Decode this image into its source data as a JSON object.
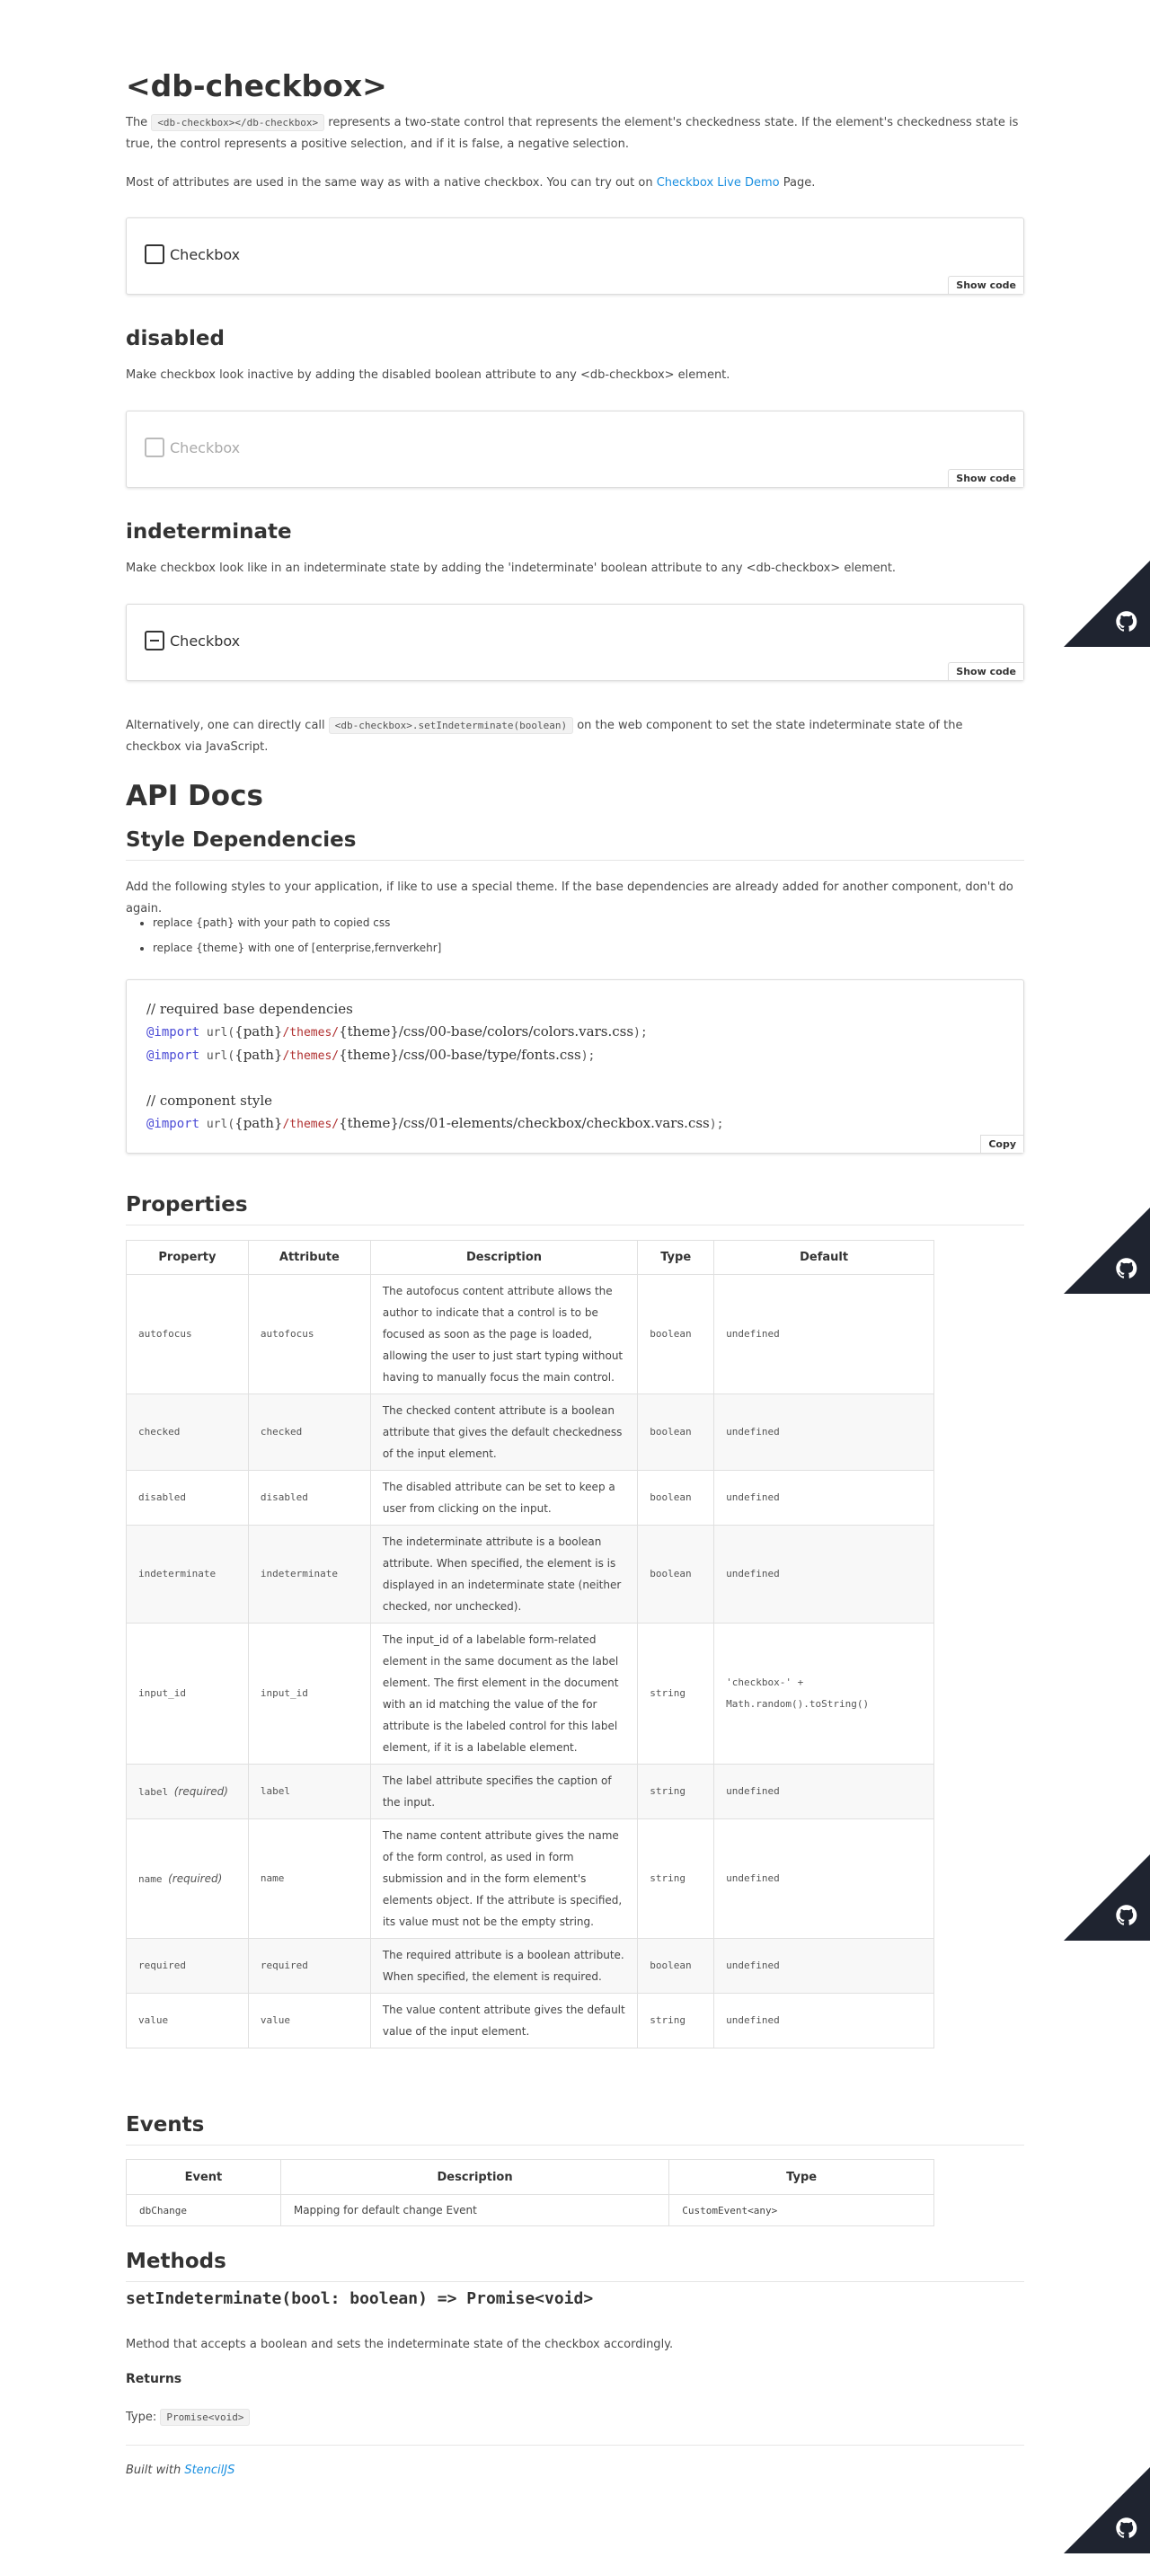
{
  "header": {
    "title": "<db-checkbox>",
    "intro_pre": "The ",
    "intro_code": "<db-checkbox></db-checkbox>",
    "intro_post_line1": " represents a two-state control that represents the element's checkedness state. If the element's checkedness state is",
    "intro_line2": "true, the control represents a positive selection, and if it is false, a negative selection.",
    "attrs_pre": "Most of attributes are used in the same way as with a native checkbox. You can try out on ",
    "attrs_link": "Checkbox Live Demo",
    "attrs_post": " Page."
  },
  "demos": {
    "default": {
      "label": "Checkbox",
      "show_code": "Show code"
    },
    "disabled": {
      "heading": "disabled",
      "description": "Make checkbox look inactive by adding the disabled boolean attribute to any <db-checkbox> element.",
      "label": "Checkbox",
      "show_code": "Show code"
    },
    "indeterminate": {
      "heading": "indeterminate",
      "description": "Make checkbox look like in an indeterminate state by adding the 'indeterminate' boolean attribute to any <db-checkbox> element.",
      "label": "Checkbox",
      "show_code": "Show code"
    },
    "alt_pre": "Alternatively, one can directly call ",
    "alt_code": "<db-checkbox>.setIndeterminate(boolean)",
    "alt_post_line1": " on the web component to set the state indeterminate state of the",
    "alt_line2": "checkbox via JavaScript."
  },
  "api": {
    "heading": "API Docs",
    "style_heading": "Style Dependencies",
    "style_intro": "Add the following styles to your application, if like to use a special theme. If the base dependencies are already added for another component, don't do again.",
    "bullets": [
      "replace {path} with your path to copied css",
      "replace {theme} with one of [enterprise,fernverkehr]"
    ],
    "code": {
      "comment1": "// required base dependencies",
      "line1": {
        "kw": "@import",
        "fn": " url(",
        "p1": "{path}",
        "s1": "/themes/",
        "p2": "{theme}",
        "rest": "/css/00-base/colors/colors.vars.css",
        "end": ");"
      },
      "line2": {
        "kw": "@import",
        "fn": " url(",
        "p1": "{path}",
        "s1": "/themes/",
        "p2": "{theme}",
        "rest": "/css/00-base/type/fonts.css",
        "end": ");"
      },
      "comment2": "// component style",
      "line3": {
        "kw": "@import",
        "fn": " url(",
        "p1": "{path}",
        "s1": "/themes/",
        "p2": "{theme}",
        "rest": "/css/01-elements/checkbox/checkbox.vars.css",
        "end": ");"
      },
      "copy": "Copy"
    }
  },
  "properties": {
    "heading": "Properties",
    "columns": [
      "Property",
      "Attribute",
      "Description",
      "Type",
      "Default"
    ],
    "rows": [
      {
        "property": "autofocus",
        "required": "",
        "attribute": "autofocus",
        "description": "The autofocus content attribute allows the author to indicate that a control is to be focused as soon as the page is loaded, allowing the user to just start typing without having to manually focus the main control.",
        "type": "boolean",
        "default": "undefined"
      },
      {
        "property": "checked",
        "required": "",
        "attribute": "checked",
        "description": "The checked content attribute is a boolean attribute that gives the default checkedness of the input element.",
        "type": "boolean",
        "default": "undefined"
      },
      {
        "property": "disabled",
        "required": "",
        "attribute": "disabled",
        "description": "The disabled attribute can be set to keep a user from clicking on the input.",
        "type": "boolean",
        "default": "undefined"
      },
      {
        "property": "indeterminate",
        "required": "",
        "attribute": "indeterminate",
        "description": "The indeterminate attribute is a boolean attribute. When specified, the element is is displayed in an indeterminate state (neither checked, nor unchecked).",
        "type": "boolean",
        "default": "undefined"
      },
      {
        "property": "input_id",
        "required": "",
        "attribute": "input_id",
        "description": "The input_id of a labelable form-related element in the same document as the label element. The first element in the document with an id matching the value of the for attribute is the labeled control for this label element, if it is a labelable element.",
        "type": "string",
        "default": "'checkbox-' + Math.random().toString()"
      },
      {
        "property": "label",
        "required": "(required)",
        "attribute": "label",
        "description": "The label attribute specifies the caption of the input.",
        "type": "string",
        "default": "undefined"
      },
      {
        "property": "name",
        "required": "(required)",
        "attribute": "name",
        "description": "The name content attribute gives the name of the form control, as used in form submission and in the form element's elements object. If the attribute is specified, its value must not be the empty string.",
        "type": "string",
        "default": "undefined"
      },
      {
        "property": "required",
        "required": "",
        "attribute": "required",
        "description": "The required attribute is a boolean attribute. When specified, the element is required.",
        "type": "boolean",
        "default": "undefined"
      },
      {
        "property": "value",
        "required": "",
        "attribute": "value",
        "description": "The value content attribute gives the default value of the input element.",
        "type": "string",
        "default": "undefined"
      }
    ]
  },
  "events": {
    "heading": "Events",
    "columns": [
      "Event",
      "Description",
      "Type"
    ],
    "rows": [
      {
        "event": "dbChange",
        "description": "Mapping for default change Event",
        "type": "CustomEvent<any>"
      }
    ]
  },
  "methods": {
    "heading": "Methods",
    "signature": "setIndeterminate(bool: boolean) => Promise<void>",
    "description": "Method that accepts a boolean and sets the indeterminate state of the checkbox accordingly.",
    "returns_heading": "Returns",
    "returns_pre": "Type: ",
    "returns_type": "Promise<void>"
  },
  "footer": {
    "built_with": "Built with ",
    "link": "StencilJS"
  },
  "colors": {
    "link": "#1a8fe0",
    "github_corner": "#1f2430"
  },
  "icons": [
    "github-icon",
    "checkbox-icon"
  ]
}
